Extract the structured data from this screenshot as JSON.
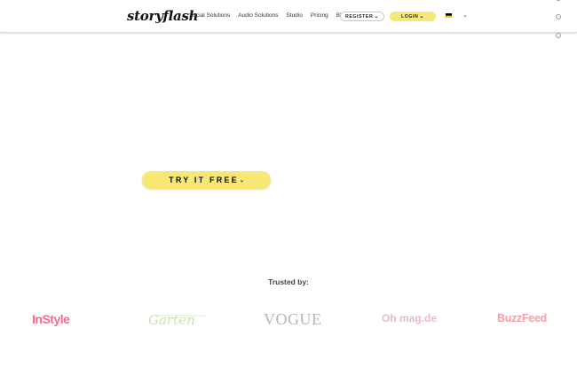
{
  "header": {
    "logo": "storyflash",
    "nav": [
      "Social Solutions",
      "Audio Solutions",
      "Studio",
      "Pricing",
      "Blog"
    ],
    "register_label": "REGISTER",
    "login_label": "LOGIN",
    "chevron": "⌄",
    "language_icon": "flag-de-icon"
  },
  "hero": {
    "cta_label": "TRY IT FREE"
  },
  "trusted": {
    "label": "Trusted by:",
    "logos": [
      "InStyle",
      "Garten",
      "VOGUE",
      "Oh mag.de",
      "BuzzFeed"
    ],
    "garten_tagline": "Deutschlands schönstes Gartenmagazin"
  },
  "colors": {
    "accent_yellow": "#f7e774",
    "header_border": "#d9d9d9"
  }
}
